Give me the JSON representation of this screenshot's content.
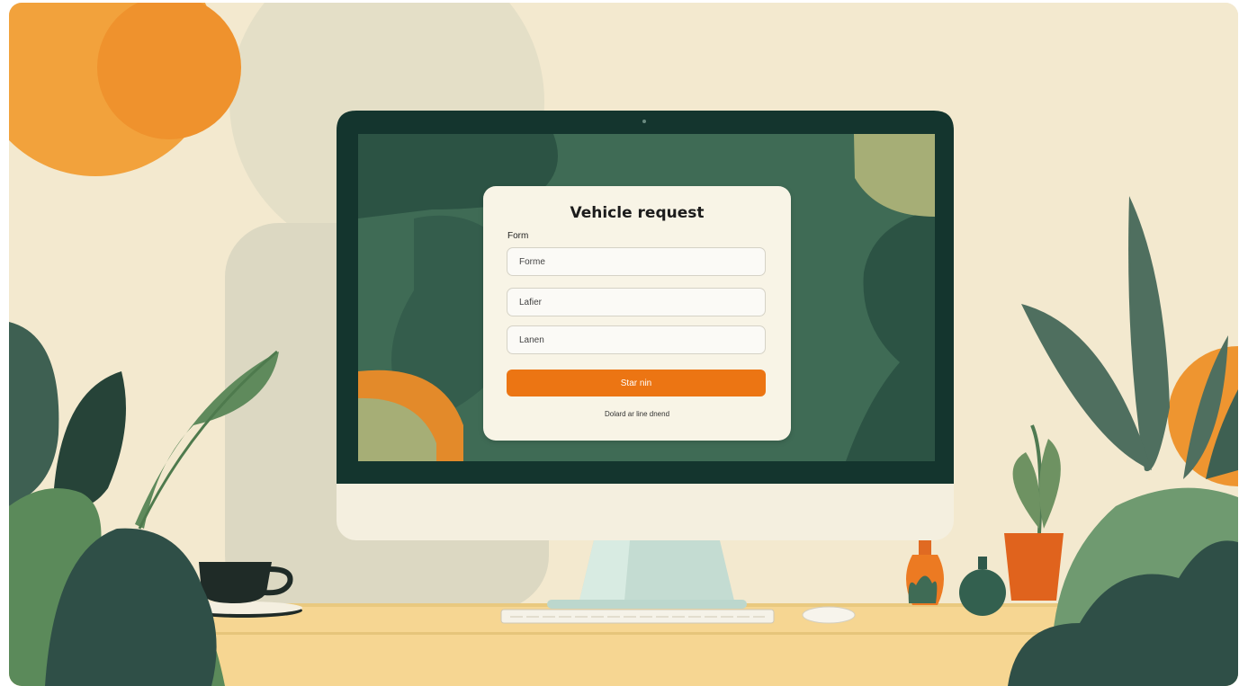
{
  "form": {
    "title": "Vehicle request",
    "label": "Form",
    "fields": [
      {
        "placeholder": "Forme"
      },
      {
        "placeholder": "Lafier"
      },
      {
        "placeholder": "Lanen"
      }
    ],
    "submit_label": "Star nin",
    "footer_text": "Dolard ar line dnend"
  },
  "colors": {
    "background": "#f3e9cf",
    "screen": "#3f6b55",
    "accent": "#ec7513",
    "card": "#f8f4e6",
    "sun": "#f2a23c"
  }
}
